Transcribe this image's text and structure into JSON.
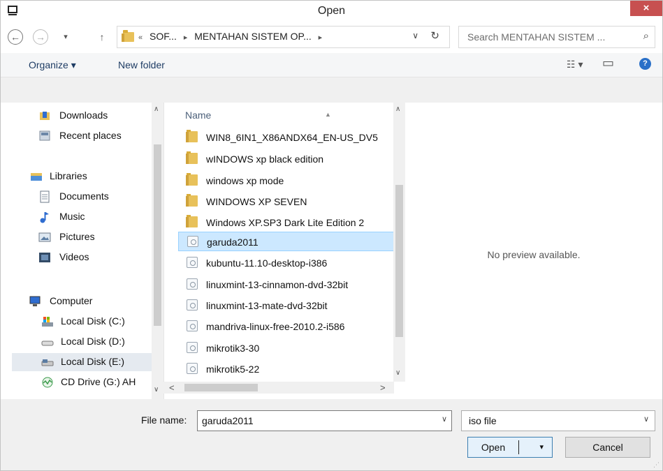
{
  "window": {
    "title": "Open",
    "close_glyph": "×"
  },
  "nav": {
    "back": "←",
    "forward": "→",
    "recent": "▾",
    "up": "↑"
  },
  "address": {
    "crumbs": [
      "«",
      "SOF...",
      "▸",
      "MENTAHAN SISTEM OP...",
      "▸"
    ],
    "dropdown_glyph": "∨",
    "refresh_glyph": "↻"
  },
  "search": {
    "placeholder": "Search MENTAHAN SISTEM ...",
    "icon_glyph": "⌕"
  },
  "toolbar": {
    "organize": "Organize ▾",
    "new_folder": "New folder",
    "view_glyph": "☷ ▾",
    "pane_glyph": "▭",
    "help_glyph": "?"
  },
  "sidebar": {
    "items": [
      {
        "label": "Downloads"
      },
      {
        "label": "Recent places"
      },
      {
        "label": "Libraries"
      },
      {
        "label": "Documents"
      },
      {
        "label": "Music"
      },
      {
        "label": "Pictures"
      },
      {
        "label": "Videos"
      },
      {
        "label": "Computer"
      },
      {
        "label": "Local Disk (C:)"
      },
      {
        "label": "Local Disk (D:)"
      },
      {
        "label": "Local Disk (E:)"
      },
      {
        "label": "CD Drive (G:) AH"
      }
    ]
  },
  "files": {
    "column_name": "Name",
    "sort_glyph": "▲",
    "rows": [
      {
        "name": "WIN8_6IN1_X86ANDX64_EN-US_DV5",
        "type": "folder"
      },
      {
        "name": "wINDOWS xp black edition",
        "type": "folder"
      },
      {
        "name": "windows xp mode",
        "type": "folder"
      },
      {
        "name": "WINDOWS XP SEVEN",
        "type": "folder"
      },
      {
        "name": "Windows XP.SP3 Dark Lite Edition 2",
        "type": "folder"
      },
      {
        "name": "garuda2011",
        "type": "iso"
      },
      {
        "name": "kubuntu-11.10-desktop-i386",
        "type": "iso"
      },
      {
        "name": "linuxmint-13-cinnamon-dvd-32bit",
        "type": "iso"
      },
      {
        "name": "linuxmint-13-mate-dvd-32bit",
        "type": "iso"
      },
      {
        "name": "mandriva-linux-free-2010.2-i586",
        "type": "iso"
      },
      {
        "name": "mikrotik3-30",
        "type": "iso"
      },
      {
        "name": "mikrotik5-22",
        "type": "iso"
      }
    ]
  },
  "preview": {
    "text": "No preview available."
  },
  "bottom": {
    "file_name_label": "File name:",
    "file_name_value": "garuda2011",
    "filter_value": "iso file",
    "open_label": "Open",
    "cancel_label": "Cancel",
    "dropdown_glyph": "∨",
    "split_glyph": "▾"
  },
  "scroll": {
    "up": "∧",
    "down": "∨",
    "left": "<",
    "right": ">"
  }
}
